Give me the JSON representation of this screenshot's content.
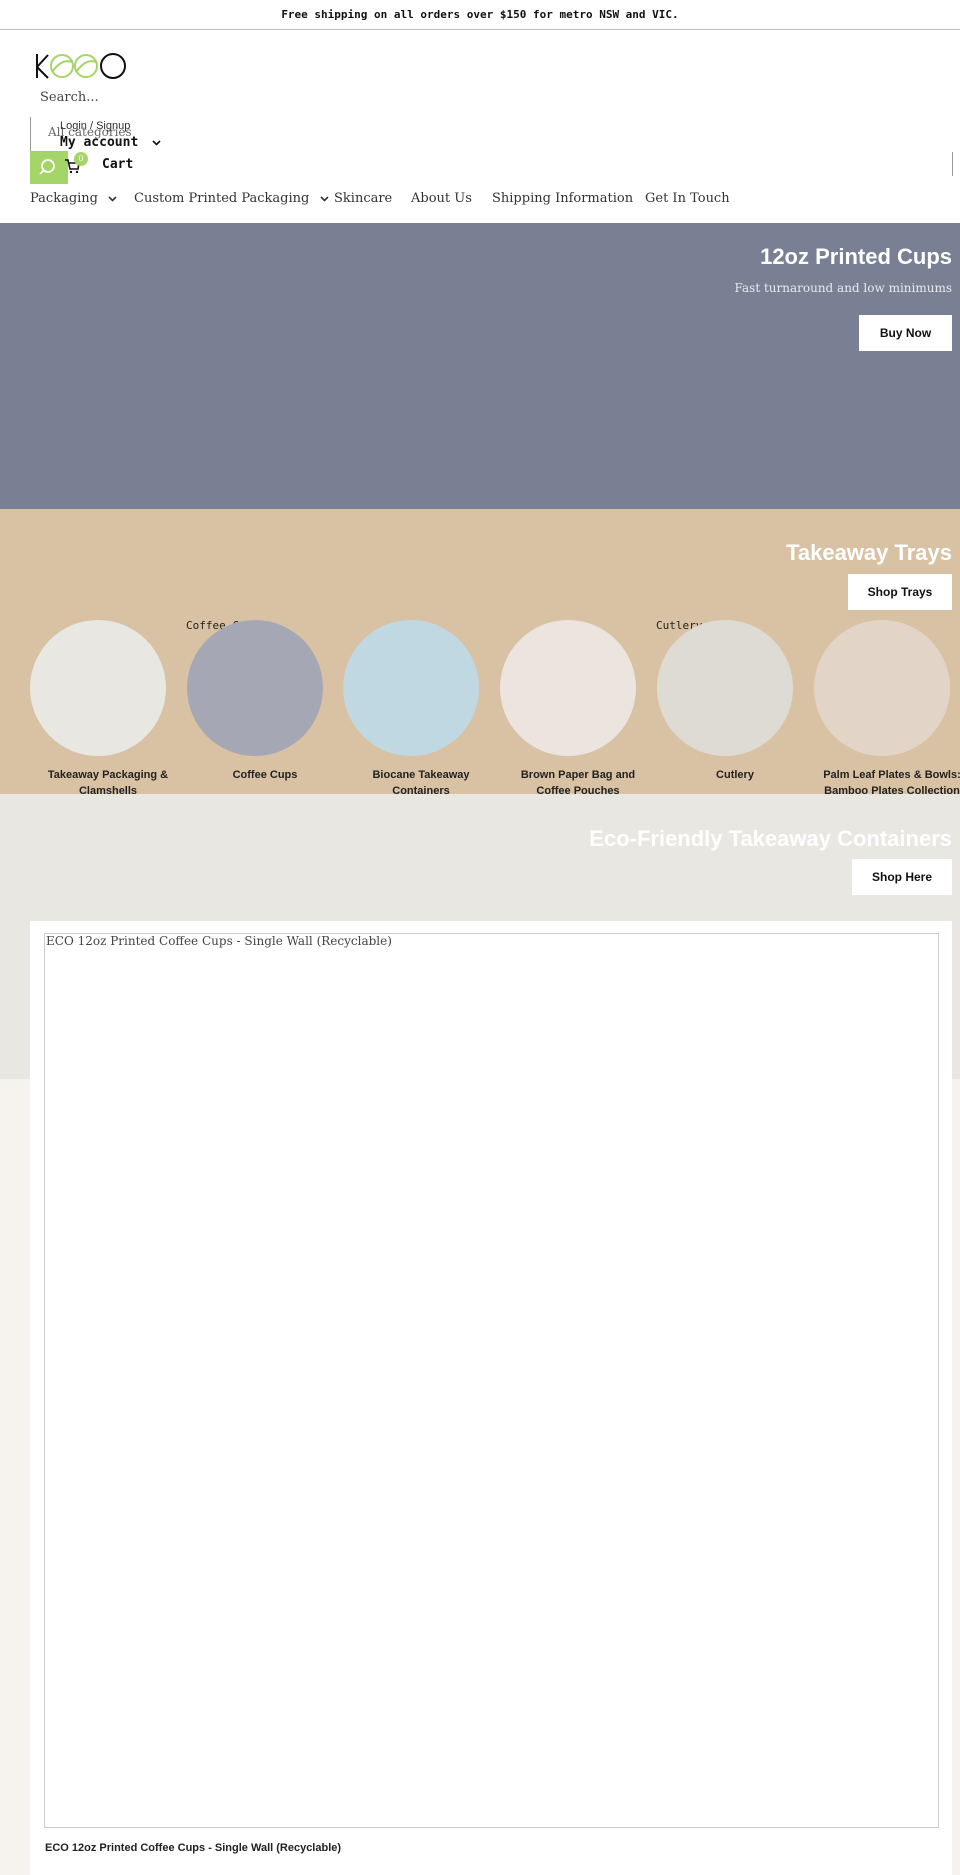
{
  "announcement": "Free shipping on all orders over $150 for metro NSW and VIC.",
  "header": {
    "search_placeholder": "Search...",
    "all_categories": "All categories",
    "login": "Login / Signup",
    "my_account": "My account",
    "cart_label": "Cart",
    "cart_count": "0",
    "accent_color": "#a5d468"
  },
  "nav": {
    "items": [
      {
        "label": "Packaging"
      },
      {
        "label": "Custom Printed Packaging"
      },
      {
        "label": "Skincare"
      },
      {
        "label": "About Us"
      },
      {
        "label": "Shipping Information"
      },
      {
        "label": "Get In Touch"
      }
    ]
  },
  "hero": {
    "title": "12oz Printed Cups",
    "subtitle": "Fast turnaround and low minimums",
    "button": "Buy Now",
    "bg_color": "#7a8093"
  },
  "trays": {
    "title": "Takeaway Trays",
    "button": "Shop Trays",
    "bg_color": "#d8c2a3"
  },
  "categories": {
    "floating_labels": [
      "Coffee Cups",
      "Cutlery"
    ],
    "items": [
      {
        "label": "Takeaway Packaging & Clamshells",
        "color": "#e8e7e1"
      },
      {
        "label": "Coffee Cups",
        "color": "#a6a7b4"
      },
      {
        "label": "Biocane Takeaway Containers",
        "color": "#bfd8e2"
      },
      {
        "label": "Brown Paper Bag and Coffee Pouches",
        "color": "#ece4df"
      },
      {
        "label": "Cutlery",
        "color": "#dedbd4"
      },
      {
        "label": "Palm Leaf Plates & Bowls: Bamboo Plates Collection",
        "color": "#e2d5c7"
      }
    ]
  },
  "eco": {
    "title": "Eco-Friendly Takeaway Containers",
    "button": "Shop Here",
    "bg_color": "#e8e7e1"
  },
  "product": {
    "image_alt": "ECO 12oz Printed Coffee Cups - Single Wall (Recyclable)",
    "name": "ECO 12oz Printed Coffee Cups - Single Wall (Recyclable)"
  }
}
